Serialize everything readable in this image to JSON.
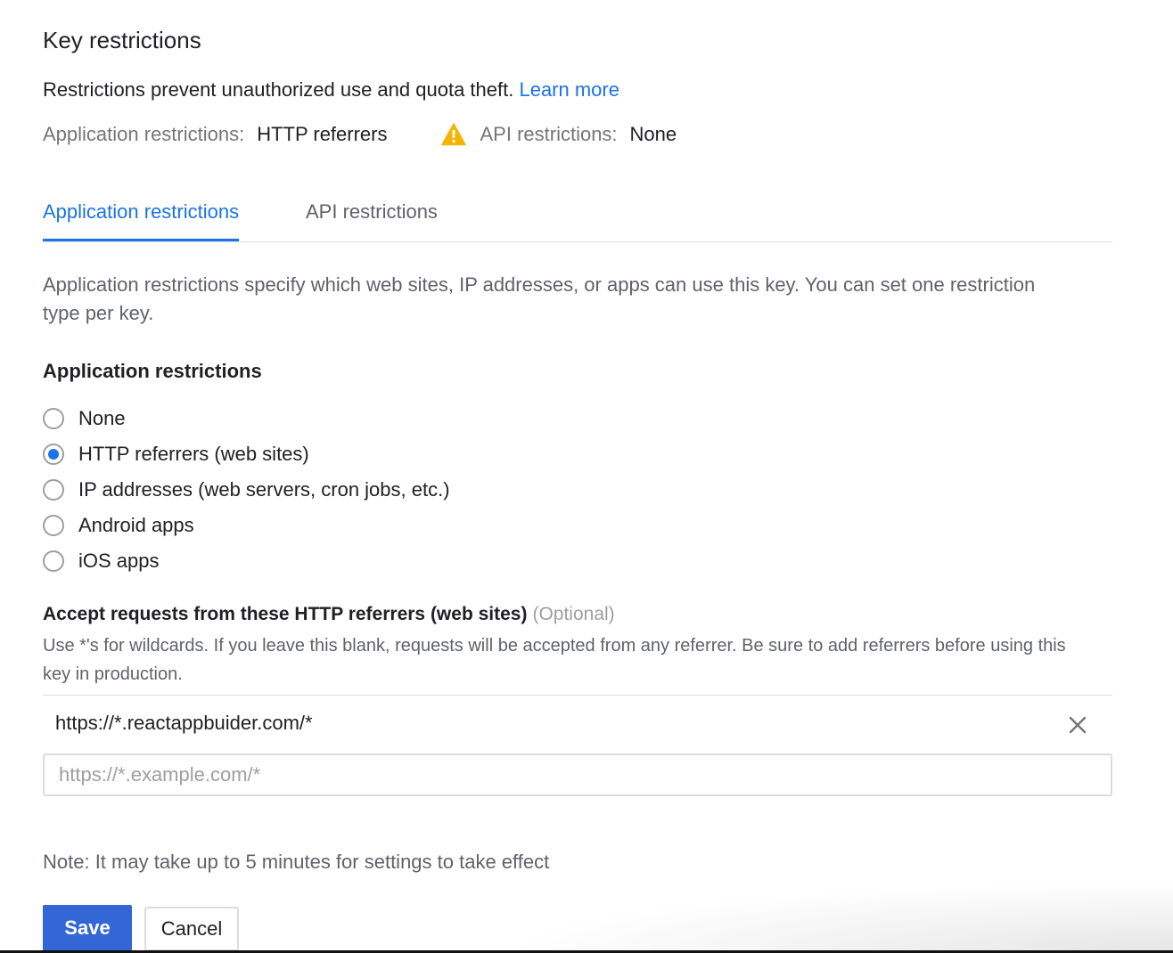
{
  "header": {
    "title": "Key restrictions",
    "intro_text": "Restrictions prevent unauthorized use and quota theft.",
    "learn_more": "Learn more"
  },
  "summary": {
    "app_label": "Application restrictions:",
    "app_value": "HTTP referrers",
    "warning_icon": "warning-triangle-icon",
    "api_label": "API restrictions:",
    "api_value": "None"
  },
  "tabs": [
    {
      "label": "Application restrictions",
      "active": true
    },
    {
      "label": "API restrictions",
      "active": false
    }
  ],
  "description": "Application restrictions specify which web sites, IP addresses, or apps can use this key. You can set one restriction type per key.",
  "restrictions": {
    "heading": "Application restrictions",
    "selected": "HTTP referrers (web sites)",
    "options": [
      {
        "label": "None"
      },
      {
        "label": "HTTP referrers (web sites)"
      },
      {
        "label": "IP addresses (web servers, cron jobs, etc.)"
      },
      {
        "label": "Android apps"
      },
      {
        "label": "iOS apps"
      }
    ]
  },
  "referrers": {
    "heading": "Accept requests from these HTTP referrers (web sites)",
    "optional": "(Optional)",
    "description": "Use *'s for wildcards. If you leave this blank, requests will be accepted from any referrer. Be sure to add referrers before using this key in production.",
    "items": [
      "https://*.reactappbuider.com/*"
    ],
    "input_value": "",
    "input_placeholder": "https://*.example.com/*"
  },
  "note": "Note: It may take up to 5 minutes for settings to take effect",
  "actions": {
    "save_label": "Save",
    "cancel_label": "Cancel"
  },
  "colors": {
    "accent": "#1a73e8",
    "save_button": "#3367d6",
    "warning": "#f4b400"
  }
}
